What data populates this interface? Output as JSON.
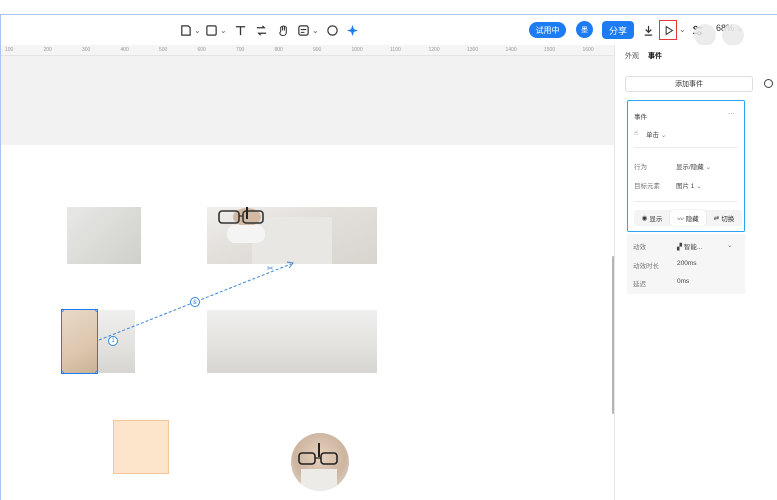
{
  "toolbar": {
    "trial_label": "试用中",
    "avatar_label": "墨",
    "share_label": "分享",
    "zoom_label": "68%"
  },
  "ruler": {
    "ticks": [
      "100",
      "200",
      "300",
      "400",
      "500",
      "600",
      "700",
      "800",
      "900",
      "1000",
      "1100",
      "1200",
      "1300",
      "1400",
      "1500",
      "1600"
    ]
  },
  "panel": {
    "tab_appearance": "外观",
    "tab_events": "事件",
    "add_event_label": "添加事件",
    "event": {
      "title": "事件",
      "more": "···",
      "trigger": "单击",
      "action_label": "行为",
      "action_value": "显示/隐藏",
      "target_label": "目标元素",
      "target_value": "图片 1",
      "segments": [
        "显示",
        "隐藏",
        "切换"
      ]
    },
    "animation": {
      "effect_label": "动效",
      "effect_value": "智能...",
      "duration_label": "动效时长",
      "duration_value": "200ms",
      "delay_label": "延迟",
      "delay_value": "0ms"
    }
  },
  "canvas": {
    "connector_badge": "1",
    "connector_mid": "⑥"
  },
  "colors": {
    "accent": "#1e7cf2",
    "highlight": "#27a6f4",
    "focus_red": "#e53935"
  }
}
